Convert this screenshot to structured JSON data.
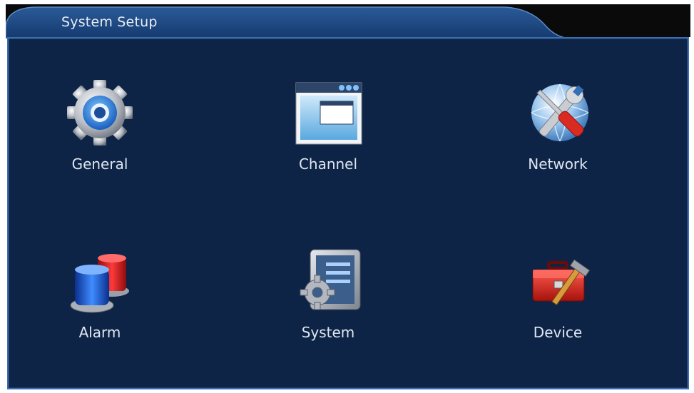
{
  "window": {
    "title": "System Setup"
  },
  "menu": {
    "items": [
      {
        "label": "General",
        "icon": "gear-icon"
      },
      {
        "label": "Channel",
        "icon": "window-icon"
      },
      {
        "label": "Network",
        "icon": "network-tools-icon"
      },
      {
        "label": "Alarm",
        "icon": "alarm-siren-icon"
      },
      {
        "label": "System",
        "icon": "system-settings-icon"
      },
      {
        "label": "Device",
        "icon": "toolbox-icon"
      }
    ]
  },
  "colors": {
    "panel_background": "#0e2447",
    "panel_border": "#3c6fb0",
    "label_text": "#dfe6f1"
  }
}
